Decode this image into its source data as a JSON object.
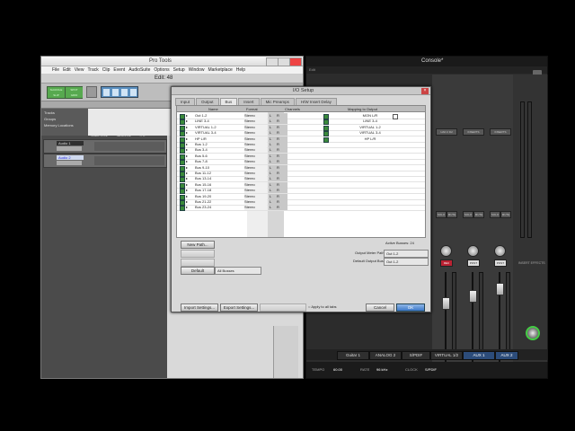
{
  "pro_tools": {
    "window_title": "Pro Tools",
    "menu": [
      "File",
      "Edit",
      "View",
      "Track",
      "Clip",
      "Event",
      "AudioSuite",
      "Options",
      "Setup",
      "Window",
      "Marketplace",
      "Help"
    ],
    "edit_title": "Edit: 48",
    "modes": [
      "SHUFFLE",
      "SPOT",
      "SLIP",
      "GRID"
    ],
    "tracks_list": [
      "Tracks",
      "Groups",
      "Memory Locations"
    ],
    "header_labels": [
      "INSERTS A-E",
      "SENDS A-E",
      "I / O"
    ],
    "tracks": [
      {
        "name": "Audio 1"
      },
      {
        "name": "Audio 2"
      }
    ]
  },
  "console": {
    "title": "Console*",
    "menu": "Edit",
    "channels": [
      "Guitar 1",
      "ANALOG 2",
      "S/PDIF",
      "VIRTUAL 1/2",
      "AUX 1",
      "AUX 2"
    ],
    "strip_labels": [
      "INSERTS",
      "INSERTS",
      "UAD 2 D2"
    ],
    "buttons": {
      "solo": "SOLO",
      "mute": "MUTE",
      "post": "POST",
      "rec": "REC"
    },
    "insert_effects": "INSERT EFFECTS",
    "bottom": {
      "tempo_label": "TEMPO",
      "tempo": "60.00",
      "rate_label": "RATE",
      "rate": "96 kHz",
      "clock_label": "CLOCK",
      "clock": "S/PDIF"
    }
  },
  "io_setup": {
    "title": "I/O Setup",
    "tabs": [
      "Input",
      "Output",
      "Bus",
      "Insert",
      "Mic Preamps",
      "H/W Insert Delay"
    ],
    "active_tab": "Bus",
    "columns": {
      "name": "Name",
      "format": "Format",
      "channels": "Channels",
      "mapping": "Mapping to Output"
    },
    "rows": [
      {
        "name": "Out 1-2",
        "format": "Stereo",
        "l": "L",
        "r": "R",
        "map": "MON L/R"
      },
      {
        "name": "LINE 3-4",
        "format": "Stereo",
        "l": "L",
        "r": "R",
        "map": "LINE 3-4"
      },
      {
        "name": "VIRTUAL 1-2",
        "format": "Stereo",
        "l": "L",
        "r": "R",
        "map": "VIRTUAL 1-2"
      },
      {
        "name": "VIRTUAL 3-4",
        "format": "Stereo",
        "l": "L",
        "r": "R",
        "map": "VIRTUAL 3-4"
      },
      {
        "name": "HP L/R",
        "format": "Stereo",
        "l": "L",
        "r": "R",
        "map": "HP L/R"
      },
      {
        "name": "Bus 1-2",
        "format": "Stereo",
        "l": "L",
        "r": "R",
        "map": ""
      },
      {
        "name": "Bus 3-4",
        "format": "Stereo",
        "l": "L",
        "r": "R",
        "map": ""
      },
      {
        "name": "Bus 5-6",
        "format": "Stereo",
        "l": "L",
        "r": "R",
        "map": ""
      },
      {
        "name": "Bus 7-8",
        "format": "Stereo",
        "l": "L",
        "r": "R",
        "map": ""
      },
      {
        "name": "Bus 9-10",
        "format": "Stereo",
        "l": "L",
        "r": "R",
        "map": ""
      },
      {
        "name": "Bus 11-12",
        "format": "Stereo",
        "l": "L",
        "r": "R",
        "map": ""
      },
      {
        "name": "Bus 13-14",
        "format": "Stereo",
        "l": "L",
        "r": "R",
        "map": ""
      },
      {
        "name": "Bus 15-16",
        "format": "Stereo",
        "l": "L",
        "r": "R",
        "map": ""
      },
      {
        "name": "Bus 17-18",
        "format": "Stereo",
        "l": "L",
        "r": "R",
        "map": ""
      },
      {
        "name": "Bus 19-20",
        "format": "Stereo",
        "l": "L",
        "r": "R",
        "map": ""
      },
      {
        "name": "Bus 21-22",
        "format": "Stereo",
        "l": "L",
        "r": "R",
        "map": ""
      },
      {
        "name": "Bus 23-24",
        "format": "Stereo",
        "l": "L",
        "r": "R",
        "map": ""
      }
    ],
    "active_busses": "Active Busses: 24",
    "output_meter_label": "Output Meter Path",
    "output_meter_value": "Out 1-2",
    "default_output_label": "Default Output Bus",
    "default_output_value": "Out 1-2",
    "new_path": "New Path...",
    "default_btn": "Default",
    "all_busses": "All Busses",
    "import_settings": "Import Settings...",
    "export_settings": "Export Settings...",
    "apply_all": "Apply to all tabs",
    "cancel": "Cancel",
    "ok": "OK"
  }
}
